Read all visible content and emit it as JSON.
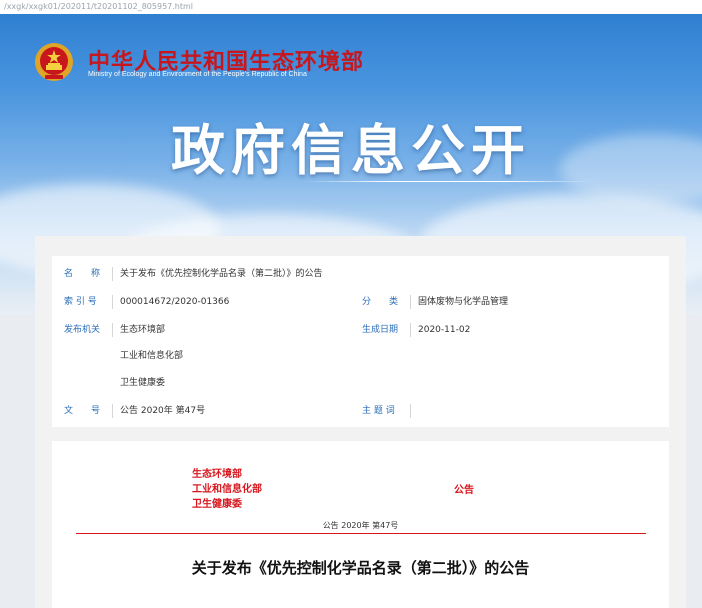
{
  "browser": {
    "url": "/xxgk/xxgk01/202011/t20201102_805957.html"
  },
  "header": {
    "site_name_cn": "中华人民共和国生态环境部",
    "site_name_en": "Ministry of Ecology and Environment of the People's Republic of China",
    "banner_title": "政府信息公开"
  },
  "meta": {
    "name_label": "名　　称",
    "name_value": "关于发布《优先控制化学品名录（第二批）》的公告",
    "index_label": "索 引 号",
    "index_value": "000014672/2020-01366",
    "category_label": "分　　类",
    "category_value": "固体废物与化学品管理",
    "issuer_label": "发布机关",
    "issuers": [
      "生态环境部",
      "工业和信息化部",
      "卫生健康委"
    ],
    "date_label": "生成日期",
    "date_value": "2020-11-02",
    "docno_label": "文　　号",
    "docno_value": "公告 2020年 第47号",
    "topic_label": "主 题 词",
    "topic_value": ""
  },
  "document": {
    "issuers": [
      "生态环境部",
      "工业和信息化部",
      "卫生健康委"
    ],
    "notice_word": "公告",
    "doc_number": "公告 2020年 第47号",
    "title": "关于发布《优先控制化学品名录（第二批）》的公告"
  },
  "colors": {
    "accent_red": "#d6171e",
    "label_blue": "#2a6db8",
    "sky_blue": "#2f7fd1"
  },
  "icons": {
    "emblem": "national-emblem-icon"
  }
}
